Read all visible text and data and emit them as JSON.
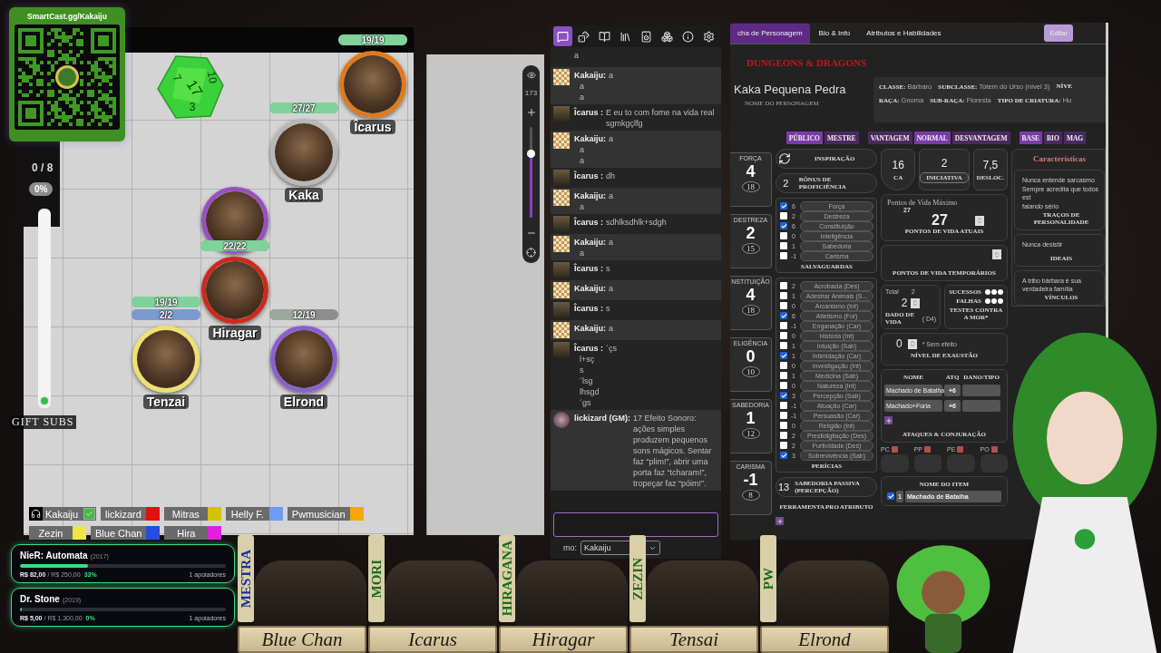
{
  "qr_card": {
    "title": "SmartCast.gg/Kakaiju"
  },
  "map": {
    "counter": "0 / 8",
    "percent": "0%",
    "slider": {
      "level": 0
    },
    "gift_label": "GIFT SUBS",
    "dice": {
      "faces": [
        "7",
        "17",
        "3",
        "10"
      ]
    },
    "tokens": [
      {
        "name": "Îcarus",
        "color": "#e07a1a",
        "bars": [
          {
            "text": "19/19",
            "level": 1,
            "color": "#7fd39a"
          }
        ]
      },
      {
        "name": "Kaka",
        "color": "#b8b8b8",
        "bars": [
          {
            "text": "27/27",
            "level": 1,
            "color": "#7fd39a"
          }
        ]
      },
      {
        "color": "#9a4fc0"
      },
      {
        "name": "Hiragar",
        "color": "#d0281c",
        "bars": [
          {
            "text": "22/22",
            "level": 1,
            "color": "#7fd39a"
          }
        ]
      },
      {
        "name": "Tenzai",
        "color": "#f0e070",
        "bars": [
          {
            "text": "19/19",
            "level": 1,
            "color": "#7fd39a"
          },
          {
            "text": "2/2",
            "level": 1,
            "color": "#7b9ad0"
          }
        ]
      },
      {
        "name": "Elrond",
        "color": "#8a5fd0",
        "bars": [
          {
            "text": "12/19",
            "level": 0.63,
            "color": "#9aa89e"
          }
        ]
      }
    ],
    "zoom": {
      "value": "173",
      "level": 0.7
    },
    "players": [
      {
        "name": "Kakaiju",
        "kind": "self",
        "checked": true
      },
      {
        "name": "lickizard",
        "kind": "player",
        "color": "#e01010"
      },
      {
        "name": "Mitras",
        "kind": "player",
        "color": "#d4c400"
      },
      {
        "name": "Helly F.",
        "kind": "player",
        "color": "#6f9cf0"
      },
      {
        "name": "Pwmusician",
        "kind": "player",
        "color": "#f5a800"
      },
      {
        "name": "Zezin",
        "kind": "player",
        "color": "#f0e640"
      },
      {
        "name": "Blue Chan",
        "kind": "player",
        "color": "#2a4be0"
      },
      {
        "name": "Hira",
        "kind": "player",
        "color": "#e020e0"
      }
    ]
  },
  "chat": {
    "tabs": [
      {
        "kind": "chat",
        "selected": true
      },
      {
        "kind": "dice",
        "selected": false
      },
      {
        "kind": "journal",
        "selected": false
      },
      {
        "kind": "library",
        "selected": false
      },
      {
        "kind": "audio",
        "selected": false
      },
      {
        "kind": "cards",
        "selected": false
      },
      {
        "kind": "info",
        "selected": false
      },
      {
        "kind": "settings",
        "selected": false
      }
    ],
    "messages": [
      {
        "kind": "continuation",
        "lines": [
          "a"
        ]
      },
      {
        "author": "Kakaiju:",
        "kind": "checkered",
        "lines": [
          "a",
          "a",
          "a"
        ]
      },
      {
        "author": "Îcarus :",
        "kind": "portrait",
        "lines": [
          "E eu to com fome na vida real sgmkgçlfg"
        ]
      },
      {
        "author": "Kakaiju:",
        "kind": "checkered",
        "lines": [
          "a",
          "a",
          "a"
        ]
      },
      {
        "author": "Îcarus :",
        "kind": "portrait",
        "lines": [
          "dh"
        ]
      },
      {
        "author": "Kakaiju:",
        "kind": "checkered",
        "lines": [
          "a",
          "a"
        ]
      },
      {
        "author": "Îcarus :",
        "kind": "portrait",
        "lines": [
          "sdhlksdhlk+sdgh"
        ]
      },
      {
        "author": "Kakaiju:",
        "kind": "checkered",
        "lines": [
          "a",
          "a"
        ]
      },
      {
        "author": "Îcarus :",
        "kind": "portrait",
        "lines": [
          "s"
        ]
      },
      {
        "author": "Kakaiju:",
        "kind": "checkered",
        "lines": [
          "a"
        ]
      },
      {
        "author": "Îcarus :",
        "kind": "portrait",
        "lines": [
          "s"
        ]
      },
      {
        "author": "Kakaiju:",
        "kind": "checkered",
        "lines": [
          "a"
        ]
      },
      {
        "author": "Îcarus :",
        "kind": "portrait",
        "lines": [
          "´çs",
          "l+sç",
          "s",
          "´lsg",
          "lhsgd",
          "´gs"
        ]
      },
      {
        "author": "lickizard (GM):",
        "kind": "round",
        "lines": [
          "17 Efeito Sonoro: ações simples produzem pequenos sons mágicos. Sentar faz “plim!”, abrir uma porta faz “tcharam!”, tropeçar faz “póim!”."
        ]
      }
    ],
    "speaking_as": {
      "label": "mo:",
      "value": "Kakaiju"
    }
  },
  "sheet": {
    "tabs": [
      {
        "label": "cha de Personagem",
        "selected": true
      },
      {
        "label": "Bio & Info",
        "selected": false
      },
      {
        "label": "Atributos e Habilidades",
        "selected": false
      }
    ],
    "edit_button": "Editar",
    "logo": "DUNGEONS & DRAGONS",
    "name": "Kaka Pequena Pedra",
    "name_caption": "NOME DO PERSONAGEM",
    "info": [
      [
        {
          "label": "CLASSE:",
          "value": "Bárbaro"
        },
        {
          "label": "SUBCLASSE:",
          "value": "Totem do Urso (nível 3)"
        },
        {
          "label": "NÍVE"
        }
      ],
      [
        {
          "label": "RAÇA:",
          "value": "Gnoma"
        },
        {
          "label": "SUB-RAÇA:",
          "value": "Floresta"
        },
        {
          "label": "TIPO DE CRIATURA:",
          "value": "Hu"
        }
      ]
    ],
    "toggle_groups": [
      [
        {
          "label": "PÚBLICO",
          "selected": true
        },
        {
          "label": "MESTRE",
          "selected": false
        }
      ],
      [
        {
          "label": "VANTAGEM",
          "selected": false
        },
        {
          "label": "NORMAL",
          "selected": true
        },
        {
          "label": "DESVANTAGEM",
          "selected": false
        }
      ],
      [
        {
          "label": "BASE",
          "selected": true
        },
        {
          "label": "BIO",
          "selected": false
        },
        {
          "label": "MAG",
          "selected": false
        }
      ]
    ],
    "abilities": [
      {
        "label": "FORÇA",
        "modifier": "4",
        "score": "18"
      },
      {
        "label": "DESTREZA",
        "modifier": "2",
        "score": "15"
      },
      {
        "label": "NSTITUIÇÃO",
        "modifier": "4",
        "score": "18"
      },
      {
        "label": "ELIGÊNCIA",
        "modifier": "0",
        "score": "10"
      },
      {
        "label": "SABEDORIA",
        "modifier": "1",
        "score": "12"
      },
      {
        "label": "CARISMA",
        "modifier": "-1",
        "score": "8"
      }
    ],
    "inspiration": "INSPIRAÇÃO",
    "proficiency": {
      "value": "2",
      "label": "BÔNUS DE PROFICIÊNCIA"
    },
    "saves": {
      "title": "SALVAGUARDAS",
      "items": [
        {
          "checked": true,
          "value": "6",
          "label": "Força"
        },
        {
          "checked": false,
          "value": "2",
          "label": "Destreza"
        },
        {
          "checked": true,
          "value": "6",
          "label": "Constituição"
        },
        {
          "checked": false,
          "value": "0",
          "label": "Inteligência"
        },
        {
          "checked": false,
          "value": "1",
          "label": "Sabedoria"
        },
        {
          "checked": false,
          "value": "-1",
          "label": "Carisma"
        }
      ]
    },
    "skills": {
      "title": "PERÍCIAS",
      "items": [
        {
          "checked": false,
          "value": "2",
          "label": "Acrobacia (Des)"
        },
        {
          "checked": false,
          "value": "1",
          "label": "Adestrar Animais (S..."
        },
        {
          "checked": false,
          "value": "0",
          "label": "Arcanismo (Int)"
        },
        {
          "checked": true,
          "value": "6",
          "label": "Atletismo (For)"
        },
        {
          "checked": false,
          "value": "-1",
          "label": "Enganação (Car)"
        },
        {
          "checked": false,
          "value": "0",
          "label": "História (Int)"
        },
        {
          "checked": false,
          "value": "1",
          "label": "Intuição (Sab)"
        },
        {
          "checked": true,
          "value": "1",
          "label": "Intimidação (Car)"
        },
        {
          "checked": false,
          "value": "0",
          "label": "Investigação (Int)"
        },
        {
          "checked": false,
          "value": "1",
          "label": "Medicina (Sab)"
        },
        {
          "checked": false,
          "value": "0",
          "label": "Natureza (Int)"
        },
        {
          "checked": true,
          "value": "3",
          "label": "Percepção (Sab)"
        },
        {
          "checked": false,
          "value": "-1",
          "label": "Atuação (Car)"
        },
        {
          "checked": false,
          "value": "-1",
          "label": "Persuasão (Car)"
        },
        {
          "checked": false,
          "value": "0",
          "label": "Religião (Int)"
        },
        {
          "checked": false,
          "value": "2",
          "label": "Prestidigitação (Des)"
        },
        {
          "checked": false,
          "value": "2",
          "label": "Furtividade (Des)"
        },
        {
          "checked": true,
          "value": "3",
          "label": "Sobrevivência (Sab)"
        }
      ]
    },
    "passive": {
      "value": "13",
      "label": "SABEDORIA PASSIVA (PERCEPÇÃO)"
    },
    "tools": [
      "FERRAMENTA",
      "PRO",
      "ATRIBUTO"
    ],
    "stats": [
      {
        "value": "16",
        "label": "CA",
        "kind": "shield"
      },
      {
        "value": "2",
        "label": "INICIATIVA",
        "kind": "pill"
      },
      {
        "value": "7,5",
        "label": "DESLOC.",
        "kind": "plain"
      }
    ],
    "hp": {
      "max_label": "Pontos de Vida Máximo",
      "max": "27",
      "current": "27",
      "current_label": "PONTOS DE VIDA ATUAIS",
      "temp_label": "PONTOS DE VIDA TEMPORÁRIOS"
    },
    "hit_dice": {
      "total_label": "Total",
      "total": "2",
      "value": "2",
      "label": "DADO DE VIDA",
      "die": "( D4)"
    },
    "death_saves": {
      "successes": "SUCESSOS",
      "failures": "FALHAS",
      "label": "TESTES CONTRA A MOR*"
    },
    "exhaustion": {
      "value": "0",
      "note": "* Sem efeito",
      "label": "NÍVEL DE EXAUSTÃO"
    },
    "attacks": {
      "headers": [
        "NOME",
        "ATQ",
        "DANO/TIPO"
      ],
      "rows": [
        {
          "name": "Machado de Batalha",
          "bonus": "+6"
        },
        {
          "name": "Machado+Fúria",
          "bonus": "+6"
        }
      ],
      "title": "ATAQUES & CONJURAÇÃO"
    },
    "coins": [
      "PC",
      "PP",
      "PE",
      "PO"
    ],
    "equipment": {
      "header": "NOME DO ITEM",
      "rows": [
        {
          "checked": true,
          "qty": "1",
          "name": "Machado de Batalha"
        }
      ]
    },
    "characteristics": {
      "title": "Características",
      "blocks": [
        {
          "lines": [
            "Nunca entende sarcasmo",
            "Sempre acredita que todos est",
            "falando sério"
          ],
          "label": "TRAÇOS DE PERSONALIDADE"
        },
        {
          "lines": [
            "Nunca desistir"
          ],
          "label": "IDEAIS"
        },
        {
          "lines": [
            "A tribo bárbara é sua verdadeira família"
          ],
          "label": "VÍNCULOS"
        }
      ]
    }
  },
  "goals": [
    {
      "title": "NieR: Automata",
      "year": "(2017)",
      "level": 0.33,
      "raised": "R$ 82,00",
      "target": "/ R$ 250,00",
      "percent": "33%",
      "supporters": "1 apoiadores"
    },
    {
      "title": "Dr. Stone",
      "year": "(2019)",
      "level": 0,
      "raised": "R$ 5,00",
      "target": "/ R$ 1.300,00",
      "percent": "0%",
      "supporters": "1 apoiadores"
    }
  ],
  "portraits": [
    {
      "tag": "MESTRA",
      "name": "Blue Chan",
      "kind": "gm"
    },
    {
      "tag": "MORI",
      "name": "Icarus",
      "kind": "player"
    },
    {
      "tag": "HIRAGANA",
      "name": "Hiragar",
      "kind": "player"
    },
    {
      "tag": "ZEZIN",
      "name": "Tensai",
      "kind": "player"
    },
    {
      "tag": "PW",
      "name": "Elrond",
      "kind": "player"
    }
  ]
}
